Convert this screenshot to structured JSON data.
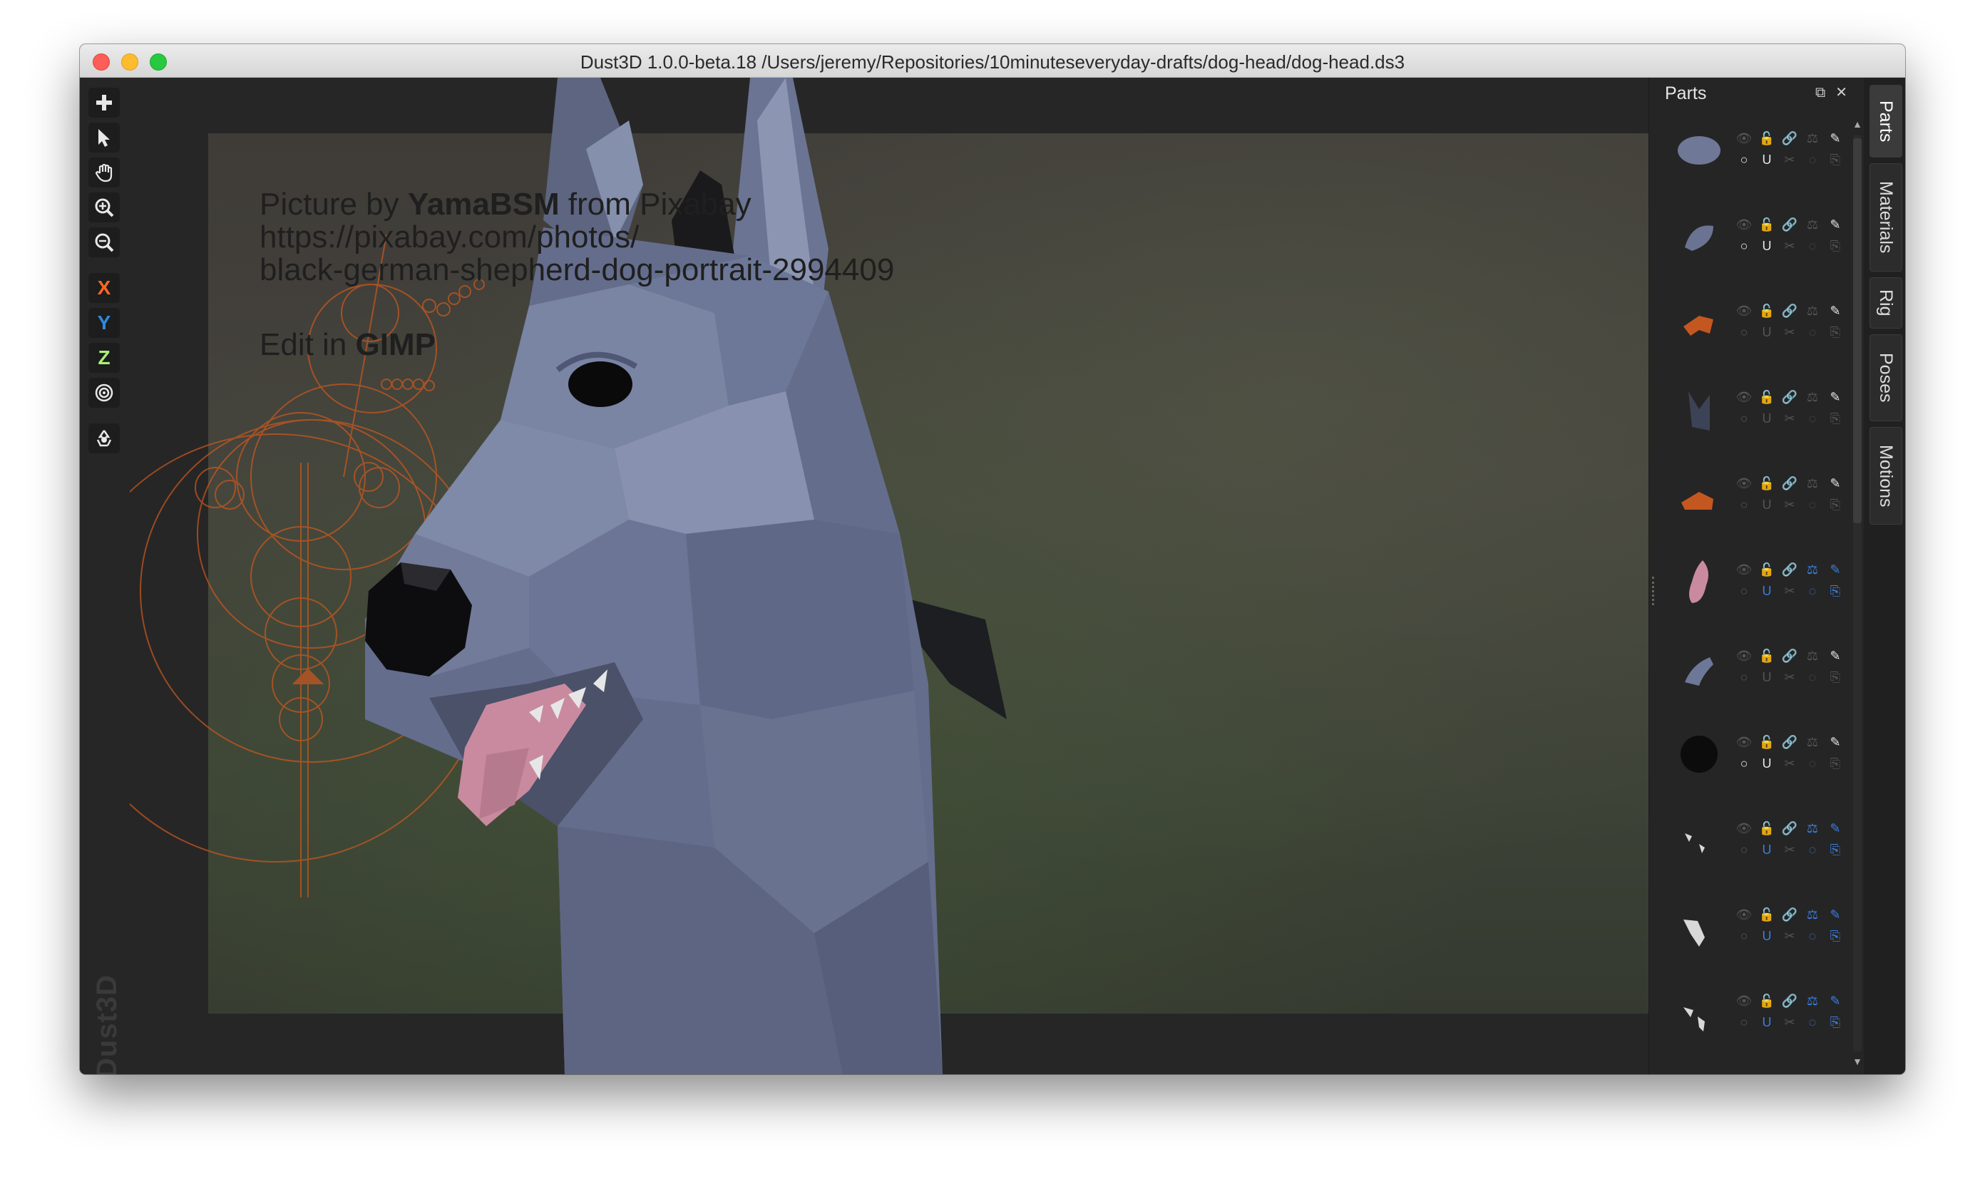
{
  "window": {
    "title": "Dust3D 1.0.0-beta.18 /Users/jeremy/Repositories/10minuteseveryday-drafts/dog-head/dog-head.ds3"
  },
  "toolbar": {
    "add_icon": "plus-icon",
    "select_icon": "pointer-icon",
    "pan_icon": "hand-icon",
    "zoom_in_icon": "zoom-in-icon",
    "zoom_out_icon": "zoom-out-icon",
    "x_label": "X",
    "y_label": "Y",
    "z_label": "Z",
    "radius_icon": "target-icon",
    "regenerate_icon": "recycle-icon"
  },
  "watermark": "Dust3D",
  "reference": {
    "credit_prefix": "Picture by ",
    "credit_author": "YamaBSM",
    "credit_suffix": " from Pixabay",
    "url_line1": "https://pixabay.com/photos/",
    "url_line2": "black-german-shepherd-dog-portrait-2994409",
    "edit_prefix": "Edit in ",
    "edit_app": "GIMP"
  },
  "parts_panel": {
    "title": "Parts",
    "detach_icon": "detach-icon",
    "close_icon": "close-icon",
    "parts": [
      {
        "color": "#6f7896",
        "shape": "blob",
        "lock": false,
        "mirror": false,
        "blue_row2": false,
        "circle": true
      },
      {
        "color": "#6a7392",
        "shape": "nose",
        "circle": true
      },
      {
        "color": "#c4571f",
        "shape": "hook"
      },
      {
        "color": "#3c4356",
        "shape": "ear"
      },
      {
        "color": "#c4571f",
        "shape": "claw"
      },
      {
        "color": "#c98aa0",
        "shape": "tongue",
        "blue": true
      },
      {
        "color": "#6d7898",
        "shape": "horn"
      },
      {
        "color": "#0c0c0c",
        "shape": "ball",
        "circle": true
      },
      {
        "color": "#d8d8d8",
        "shape": "teeth",
        "blue": true
      },
      {
        "color": "#d8d8d8",
        "shape": "teeth2",
        "blue": true
      },
      {
        "color": "#d8d8d8",
        "shape": "teeth3",
        "blue": true
      },
      {
        "color": "#d8d8d8",
        "shape": "teeth4",
        "blue": true
      }
    ]
  },
  "tabs": [
    {
      "label": "Parts",
      "active": true
    },
    {
      "label": "Materials",
      "active": false
    },
    {
      "label": "Rig",
      "active": false
    },
    {
      "label": "Poses",
      "active": false
    },
    {
      "label": "Motions",
      "active": false
    }
  ],
  "colors": {
    "accent_orange": "#fc6621",
    "axis_y": "#2d8be0",
    "axis_z": "#aaf07a",
    "model": "#6d7898",
    "tongue": "#c98aa0"
  }
}
